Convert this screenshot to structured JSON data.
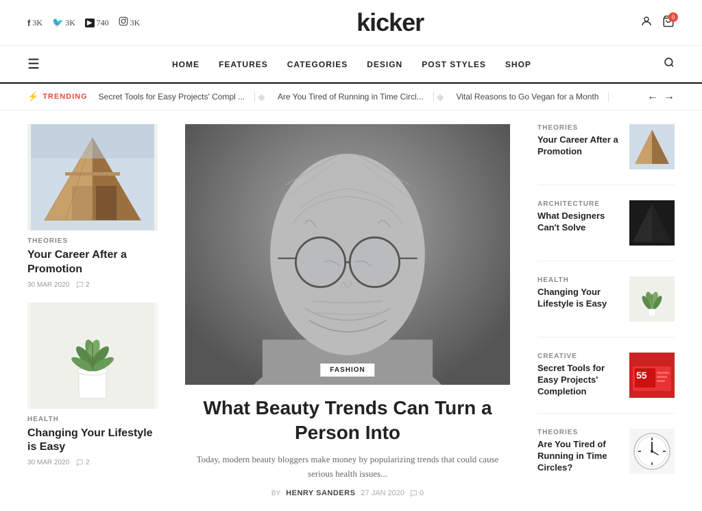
{
  "topbar": {
    "social": [
      {
        "icon": "f",
        "label": "3K",
        "name": "facebook"
      },
      {
        "icon": "🐦",
        "label": "3K",
        "name": "twitter"
      },
      {
        "icon": "▶",
        "label": "740",
        "name": "youtube"
      },
      {
        "icon": "📷",
        "label": "3K",
        "name": "instagram"
      }
    ],
    "logo": "kicker",
    "cart_count": "0"
  },
  "nav": {
    "menu_icon": "☰",
    "links": [
      "HOME",
      "FEATURES",
      "CATEGORIES",
      "DESIGN",
      "POST STYLES",
      "SHOP"
    ],
    "search_icon": "🔍"
  },
  "trending": {
    "label": "TRENDING",
    "items": [
      "Secret Tools for Easy Projects' Compl ...",
      "Are You Tired of Running in Time Circl...",
      "Vital Reasons to Go Vegan for a Month"
    ]
  },
  "left_articles": [
    {
      "category": "THEORIES",
      "title": "Your Career After a Promotion",
      "date": "30 MAR 2020",
      "comments": "2",
      "thumb_type": "building"
    },
    {
      "category": "HEALTH",
      "title": "Changing Your Lifestyle is Easy",
      "date": "30 MAR 2020",
      "comments": "2",
      "thumb_type": "plant"
    }
  ],
  "featured": {
    "category": "FASHION",
    "title": "What Beauty Trends Can Turn a Person Into",
    "description": "Today, modern beauty bloggers make money by popularizing trends that could cause serious health issues...",
    "by": "BY",
    "author": "HENRY SANDERS",
    "date": "27 JAN 2020",
    "comments": "0"
  },
  "right_articles": [
    {
      "category": "THEORIES",
      "title": "Your Career After a Promotion",
      "thumb_type": "building"
    },
    {
      "category": "ARCHITECTURE",
      "title": "What Designers Can't Solve",
      "thumb_type": "dark"
    },
    {
      "category": "HEALTH",
      "title": "Changing Your Lifestyle is Easy",
      "thumb_type": "plant"
    },
    {
      "category": "CREATIVE",
      "title": "Secret Tools for Easy Projects' Completion",
      "thumb_type": "tools"
    },
    {
      "category": "THEORIES",
      "title": "Are You Tired of Running in Time Circles?",
      "thumb_type": "clock"
    }
  ]
}
